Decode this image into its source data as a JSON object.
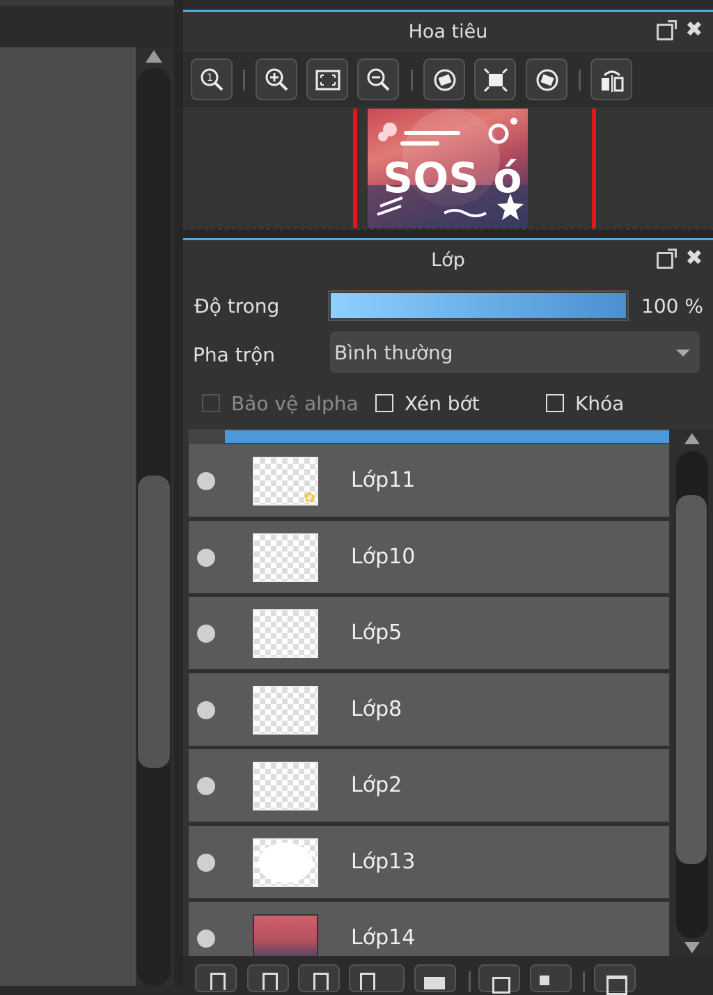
{
  "navigator": {
    "title": "Hoa tiêu",
    "toolbar_icons": [
      "zoom-actual-icon",
      "zoom-in-icon",
      "fit-screen-icon",
      "zoom-out-icon",
      "rotate-left-icon",
      "fit-rotate-icon",
      "rotate-right-icon",
      "flip-horizontal-icon"
    ]
  },
  "layers_panel": {
    "title": "Lớp",
    "opacity_label": "Độ trong",
    "opacity_value": "100 %",
    "opacity_fraction": 1.0,
    "blend_label": "Pha trộn",
    "blend_value": "Bình thường",
    "protect_alpha_label": "Bảo vệ alpha",
    "clip_label": "Xén bớt",
    "lock_label": "Khóa",
    "layers": [
      {
        "name": "Lớp11"
      },
      {
        "name": "Lớp10"
      },
      {
        "name": "Lớp5"
      },
      {
        "name": "Lớp8"
      },
      {
        "name": "Lớp2"
      },
      {
        "name": "Lớp13"
      },
      {
        "name": "Lớp14"
      }
    ]
  },
  "preview_text": "SOS ó",
  "colors": {
    "accent": "#4d98d8",
    "panel": "#333333",
    "row": "#5a5a5a",
    "canvas_bound": "#e01818"
  }
}
